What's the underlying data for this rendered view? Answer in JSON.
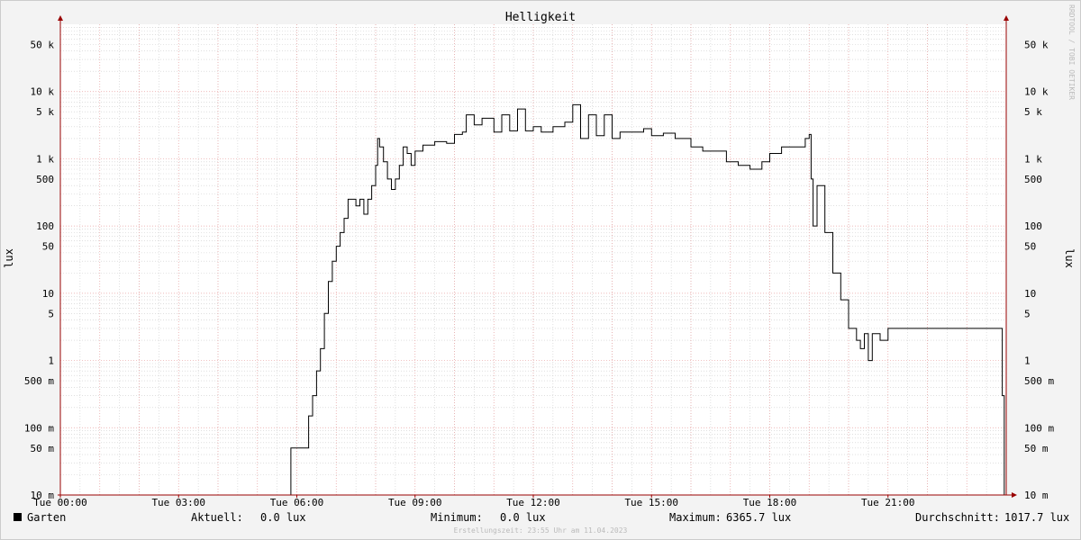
{
  "chart_data": {
    "type": "line",
    "title": "Helligkeit",
    "ylabel": "lux",
    "yscale": "log",
    "ylim": [
      0.01,
      100000
    ],
    "xlim": [
      "00:00",
      "24:00"
    ],
    "y_ticks": [
      {
        "value": 50000,
        "label": "50 k"
      },
      {
        "value": 10000,
        "label": "10 k"
      },
      {
        "value": 5000,
        "label": "5 k"
      },
      {
        "value": 1000,
        "label": "1 k"
      },
      {
        "value": 500,
        "label": "500"
      },
      {
        "value": 100,
        "label": "100"
      },
      {
        "value": 50,
        "label": "50"
      },
      {
        "value": 10,
        "label": "10"
      },
      {
        "value": 5,
        "label": "5"
      },
      {
        "value": 1,
        "label": "1"
      },
      {
        "value": 0.5,
        "label": "500 m"
      },
      {
        "value": 0.1,
        "label": "100 m"
      },
      {
        "value": 0.05,
        "label": "50 m"
      },
      {
        "value": 0.01,
        "label": "10 m"
      }
    ],
    "x_ticks": [
      {
        "hour": 0,
        "label": "Tue 00:00"
      },
      {
        "hour": 3,
        "label": "Tue 03:00"
      },
      {
        "hour": 6,
        "label": "Tue 06:00"
      },
      {
        "hour": 9,
        "label": "Tue 09:00"
      },
      {
        "hour": 12,
        "label": "Tue 12:00"
      },
      {
        "hour": 15,
        "label": "Tue 15:00"
      },
      {
        "hour": 18,
        "label": "Tue 18:00"
      },
      {
        "hour": 21,
        "label": "Tue 21:00"
      }
    ],
    "grid": true,
    "series": [
      {
        "name": "Garten",
        "color": "#000000",
        "points": [
          [
            0.0,
            0.01
          ],
          [
            5.83,
            0.01
          ],
          [
            5.85,
            0.05
          ],
          [
            6.2,
            0.05
          ],
          [
            6.3,
            0.15
          ],
          [
            6.4,
            0.3
          ],
          [
            6.5,
            0.7
          ],
          [
            6.6,
            1.5
          ],
          [
            6.7,
            5
          ],
          [
            6.8,
            15
          ],
          [
            6.9,
            30
          ],
          [
            7.0,
            50
          ],
          [
            7.1,
            80
          ],
          [
            7.2,
            130
          ],
          [
            7.3,
            250
          ],
          [
            7.5,
            200
          ],
          [
            7.6,
            250
          ],
          [
            7.7,
            150
          ],
          [
            7.8,
            250
          ],
          [
            7.9,
            400
          ],
          [
            8.0,
            800
          ],
          [
            8.05,
            2000
          ],
          [
            8.1,
            1500
          ],
          [
            8.2,
            900
          ],
          [
            8.3,
            500
          ],
          [
            8.4,
            350
          ],
          [
            8.5,
            500
          ],
          [
            8.6,
            800
          ],
          [
            8.7,
            1500
          ],
          [
            8.8,
            1200
          ],
          [
            8.9,
            800
          ],
          [
            9.0,
            1300
          ],
          [
            9.2,
            1600
          ],
          [
            9.5,
            1800
          ],
          [
            9.8,
            1700
          ],
          [
            10.0,
            2300
          ],
          [
            10.2,
            2500
          ],
          [
            10.3,
            4500
          ],
          [
            10.5,
            3200
          ],
          [
            10.7,
            4000
          ],
          [
            11.0,
            2500
          ],
          [
            11.2,
            4500
          ],
          [
            11.4,
            2600
          ],
          [
            11.6,
            5500
          ],
          [
            11.8,
            2600
          ],
          [
            12.0,
            3000
          ],
          [
            12.2,
            2500
          ],
          [
            12.5,
            3000
          ],
          [
            12.8,
            3500
          ],
          [
            13.0,
            6366
          ],
          [
            13.2,
            2000
          ],
          [
            13.4,
            4500
          ],
          [
            13.6,
            2200
          ],
          [
            13.8,
            4500
          ],
          [
            14.0,
            2000
          ],
          [
            14.2,
            2500
          ],
          [
            14.5,
            2500
          ],
          [
            14.8,
            2800
          ],
          [
            15.0,
            2200
          ],
          [
            15.3,
            2400
          ],
          [
            15.6,
            2000
          ],
          [
            16.0,
            1500
          ],
          [
            16.3,
            1300
          ],
          [
            16.6,
            1300
          ],
          [
            16.9,
            900
          ],
          [
            17.2,
            800
          ],
          [
            17.5,
            700
          ],
          [
            17.8,
            900
          ],
          [
            18.0,
            1200
          ],
          [
            18.3,
            1500
          ],
          [
            18.6,
            1500
          ],
          [
            18.9,
            2000
          ],
          [
            19.0,
            2300
          ],
          [
            19.05,
            500
          ],
          [
            19.1,
            100
          ],
          [
            19.2,
            400
          ],
          [
            19.4,
            80
          ],
          [
            19.6,
            20
          ],
          [
            19.8,
            8
          ],
          [
            20.0,
            3
          ],
          [
            20.2,
            2
          ],
          [
            20.3,
            1.5
          ],
          [
            20.4,
            2.5
          ],
          [
            20.5,
            1
          ],
          [
            20.6,
            2.5
          ],
          [
            20.8,
            2
          ],
          [
            21.0,
            3
          ],
          [
            21.5,
            3
          ],
          [
            22.0,
            3
          ],
          [
            22.5,
            3
          ],
          [
            23.0,
            3
          ],
          [
            23.85,
            3
          ],
          [
            23.9,
            0.3
          ],
          [
            23.95,
            0.01
          ]
        ]
      }
    ]
  },
  "legend": {
    "series_name": "Garten",
    "aktuell_label": "Aktuell:",
    "aktuell_value": "0.0 lux",
    "minimum_label": "Minimum:",
    "minimum_value": "0.0 lux",
    "maximum_label": "Maximum:",
    "maximum_value": "6365.7 lux",
    "durchschnitt_label": "Durchschnitt:",
    "durchschnitt_value": "1017.7 lux"
  },
  "credit": "RRDTOOL / TOBI OETIKER",
  "footer": "Erstellungszeit: 23:55 Uhr am 11.04.2023",
  "colors": {
    "major_grid": "#e8a0a0",
    "minor_grid": "#cccccc",
    "axis": "#990000",
    "background": "#f3f3f3",
    "canvas": "#ffffff"
  }
}
